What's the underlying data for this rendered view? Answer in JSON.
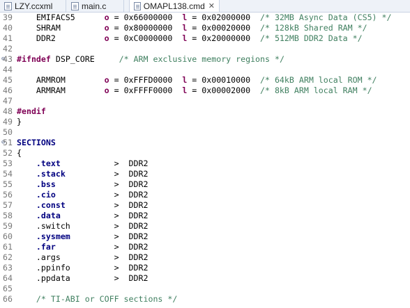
{
  "tabs": [
    {
      "label": "LZY.ccxml",
      "active": false
    },
    {
      "label": "main.c",
      "active": false
    },
    {
      "label": "OMAPL138.cmd",
      "active": true,
      "close": "✕"
    }
  ],
  "lines": [
    {
      "num": "39",
      "parts": [
        [
          "",
          "    EMIFACS5      "
        ],
        [
          "op",
          "o"
        ],
        [
          "",
          " = 0x66000000  "
        ],
        [
          "op",
          "l"
        ],
        [
          "",
          " = 0x02000000  "
        ],
        [
          "cm",
          "/* 32MB Async Data (CS5) */"
        ]
      ]
    },
    {
      "num": "40",
      "parts": [
        [
          "",
          "    SHRAM         "
        ],
        [
          "op",
          "o"
        ],
        [
          "",
          " = 0x80000000  "
        ],
        [
          "op",
          "l"
        ],
        [
          "",
          " = 0x00020000  "
        ],
        [
          "cm",
          "/* 128kB Shared RAM */"
        ]
      ]
    },
    {
      "num": "41",
      "parts": [
        [
          "",
          "    DDR2          "
        ],
        [
          "op",
          "o"
        ],
        [
          "",
          " = 0xC0000000  "
        ],
        [
          "op",
          "l"
        ],
        [
          "",
          " = 0x20000000  "
        ],
        [
          "cm",
          "/* 512MB DDR2 Data */"
        ]
      ]
    },
    {
      "num": "42",
      "parts": []
    },
    {
      "num": "43",
      "parts": [
        [
          "kw",
          "#ifndef"
        ],
        [
          "",
          " DSP_CORE     "
        ],
        [
          "cm",
          "/* ARM exclusive memory regions */"
        ]
      ]
    },
    {
      "num": "44",
      "parts": []
    },
    {
      "num": "45",
      "parts": [
        [
          "",
          "    ARMROM        "
        ],
        [
          "op",
          "o"
        ],
        [
          "",
          " = 0xFFFD0000  "
        ],
        [
          "op",
          "l"
        ],
        [
          "",
          " = 0x00010000  "
        ],
        [
          "cm",
          "/* 64kB ARM local ROM */"
        ]
      ]
    },
    {
      "num": "46",
      "parts": [
        [
          "",
          "    ARMRAM        "
        ],
        [
          "op",
          "o"
        ],
        [
          "",
          " = 0xFFFF0000  "
        ],
        [
          "op",
          "l"
        ],
        [
          "",
          " = 0x00002000  "
        ],
        [
          "cm",
          "/* 8kB ARM local RAM */"
        ]
      ]
    },
    {
      "num": "47",
      "parts": []
    },
    {
      "num": "48",
      "parts": [
        [
          "kw",
          "#endif"
        ]
      ]
    },
    {
      "num": "49",
      "parts": [
        [
          "",
          "}"
        ]
      ]
    },
    {
      "num": "50",
      "parts": []
    },
    {
      "num": "51",
      "parts": [
        [
          "sec",
          "SECTIONS"
        ]
      ]
    },
    {
      "num": "52",
      "parts": [
        [
          "",
          "{"
        ]
      ]
    },
    {
      "num": "53",
      "parts": [
        [
          "",
          "    "
        ],
        [
          "sec",
          ".text"
        ],
        [
          "",
          "           >  DDR2"
        ]
      ]
    },
    {
      "num": "54",
      "parts": [
        [
          "",
          "    "
        ],
        [
          "sec",
          ".stack"
        ],
        [
          "",
          "          >  DDR2"
        ]
      ]
    },
    {
      "num": "55",
      "parts": [
        [
          "",
          "    "
        ],
        [
          "sec",
          ".bss"
        ],
        [
          "",
          "            >  DDR2"
        ]
      ]
    },
    {
      "num": "56",
      "parts": [
        [
          "",
          "    "
        ],
        [
          "sec",
          ".cio"
        ],
        [
          "",
          "            >  DDR2"
        ]
      ]
    },
    {
      "num": "57",
      "parts": [
        [
          "",
          "    "
        ],
        [
          "sec",
          ".const"
        ],
        [
          "",
          "          >  DDR2"
        ]
      ]
    },
    {
      "num": "58",
      "parts": [
        [
          "",
          "    "
        ],
        [
          "sec",
          ".data"
        ],
        [
          "",
          "           >  DDR2"
        ]
      ]
    },
    {
      "num": "59",
      "parts": [
        [
          "",
          "    .switch         >  DDR2"
        ]
      ]
    },
    {
      "num": "60",
      "parts": [
        [
          "",
          "    "
        ],
        [
          "sec",
          ".sysmem"
        ],
        [
          "",
          "         >  DDR2"
        ]
      ]
    },
    {
      "num": "61",
      "parts": [
        [
          "",
          "    "
        ],
        [
          "sec",
          ".far"
        ],
        [
          "",
          "            >  DDR2"
        ]
      ]
    },
    {
      "num": "62",
      "parts": [
        [
          "",
          "    .args           >  DDR2"
        ]
      ]
    },
    {
      "num": "63",
      "parts": [
        [
          "",
          "    .ppinfo         >  DDR2"
        ]
      ]
    },
    {
      "num": "64",
      "parts": [
        [
          "",
          "    .ppdata         >  DDR2"
        ]
      ]
    },
    {
      "num": "65",
      "parts": []
    },
    {
      "num": "66",
      "parts": [
        [
          "",
          "    "
        ],
        [
          "cm",
          "/* TI-ABI or COFF sections */"
        ]
      ]
    }
  ],
  "folds": [
    "43",
    "51"
  ]
}
